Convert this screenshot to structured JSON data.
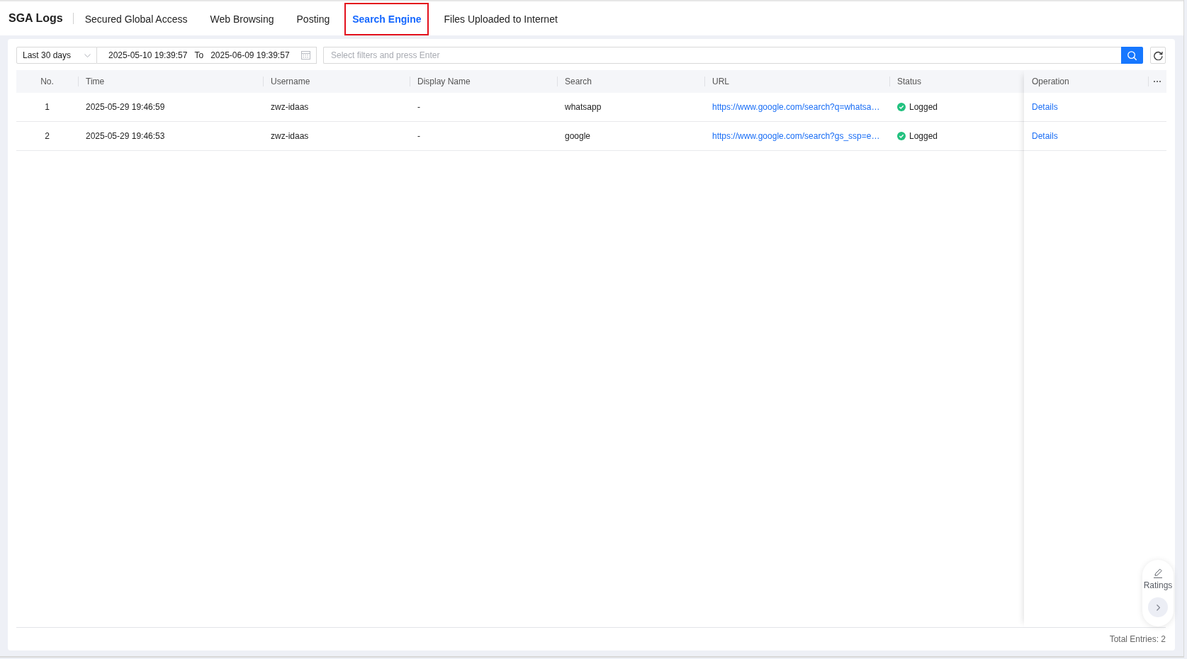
{
  "header": {
    "title": "SGA Logs",
    "tabs": [
      {
        "label": "Secured Global Access",
        "selected": false
      },
      {
        "label": "Web Browsing",
        "selected": false
      },
      {
        "label": "Posting",
        "selected": false
      },
      {
        "label": "Search Engine",
        "selected": true
      },
      {
        "label": "Files Uploaded to Internet",
        "selected": false
      }
    ]
  },
  "toolbar": {
    "time_range": "Last 30 days",
    "start": "2025-05-10 19:39:57",
    "range_separator": "To",
    "end": "2025-06-09 19:39:57",
    "filter": {
      "placeholder": "Select filters and press Enter"
    }
  },
  "table": {
    "columns": [
      "No.",
      "Time",
      "Username",
      "Display Name",
      "Search",
      "URL",
      "Status",
      "Operation"
    ],
    "rows": [
      {
        "no": "1",
        "time": "2025-05-29 19:46:59",
        "username": "zwz-idaas",
        "display_name": "-",
        "search": "whatsapp",
        "url": "https://www.google.com/search?q=whatsa…",
        "status": "Logged",
        "operation": "Details"
      },
      {
        "no": "2",
        "time": "2025-05-29 19:46:53",
        "username": "zwz-idaas",
        "display_name": "-",
        "search": "google",
        "url": "https://www.google.com/search?gs_ssp=e…",
        "status": "Logged",
        "operation": "Details"
      }
    ]
  },
  "footer": {
    "total": "Total Entries: 2"
  },
  "ratings": {
    "label": "Ratings"
  }
}
